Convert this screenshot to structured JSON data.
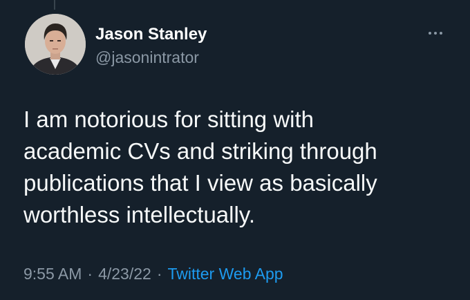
{
  "author": {
    "name": "Jason Stanley",
    "handle": "@jasonintrator"
  },
  "tweet": {
    "lines": [
      "I am notorious for sitting with",
      "academic CVs and striking through",
      "publications that I view as basically",
      "worthless intellectually."
    ]
  },
  "meta": {
    "time": "9:55 AM",
    "separator": "·",
    "date": "4/23/22",
    "source": "Twitter Web App"
  },
  "colors": {
    "background": "#15202b",
    "secondary_text": "#8b98a5",
    "link": "#1d9bf0"
  },
  "icons": {
    "more": "more-horizontal-icon"
  }
}
